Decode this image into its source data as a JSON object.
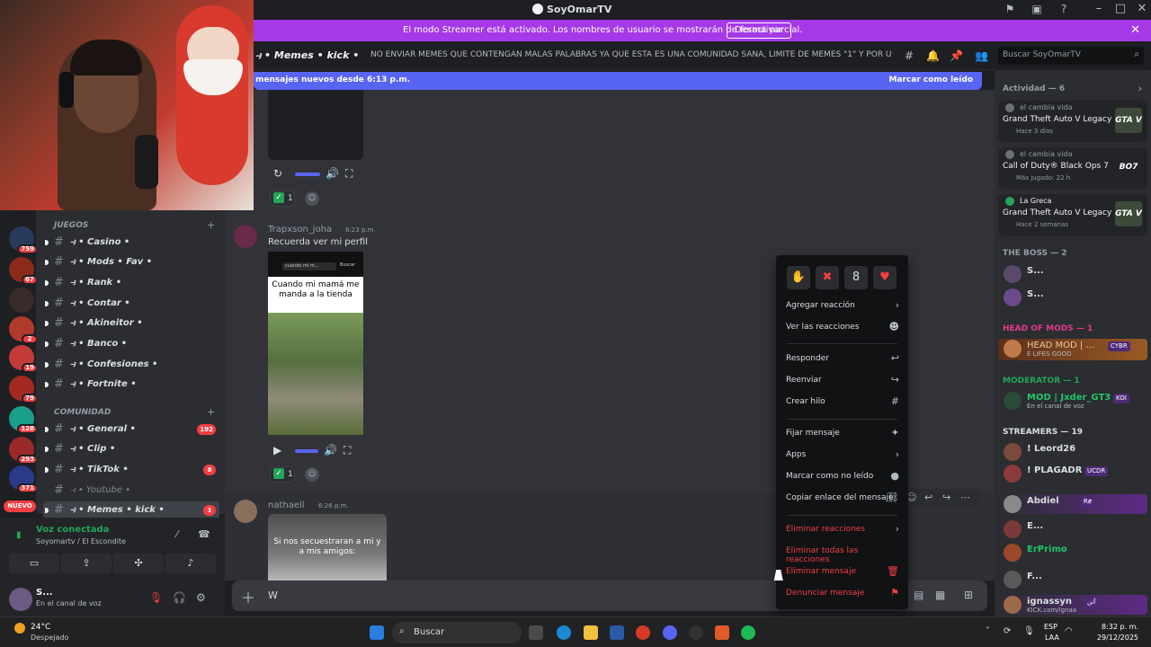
{
  "window": {
    "title": "SoyOmarTV"
  },
  "streamer_banner": {
    "text": "El modo Streamer está activado. Los nombres de usuario se mostrarán de forma parcial.",
    "button": "Desactivar"
  },
  "channel_header": {
    "name": "⥽ • Memes • kick •",
    "topic": "NO ENVIAR MEMES QUE CONTENGAN MALAS PALABRAS YA QUE ESTA ES UNA COMUNIDAD SANA, LIMITE DE MEMES \"1\" Y POR ULTIMO E...",
    "search_placeholder": "Buscar SoyOmarTV"
  },
  "new_messages_bar": {
    "left": "mensajes nuevos desde 6:13 p.m.",
    "right": "Marcar como leído"
  },
  "server_rail": {
    "badges": [
      "759",
      "67",
      "2",
      "19",
      "79",
      "128",
      "293",
      "371"
    ],
    "nuevo": "NUEVO"
  },
  "channels": {
    "cat_juegos": "JUEGOS",
    "cat_comunidad": "COMUNIDAD",
    "items": [
      {
        "label": "⥽ • Casino •"
      },
      {
        "label": "⥽ • Mods • Fav •"
      },
      {
        "label": "⥽ • Rank •"
      },
      {
        "label": "⥽ • Contar •"
      },
      {
        "label": "⥽ • Akineitor •"
      },
      {
        "label": "⥽ • Banco •"
      },
      {
        "label": "⥽ • Confesiones •"
      },
      {
        "label": "⥽ • Fortnite •"
      },
      {
        "label": "⥽ • General •",
        "badge": "192"
      },
      {
        "label": "⥽ • Clip •"
      },
      {
        "label": "⥽ • TikTok •",
        "badge": "8"
      },
      {
        "label": "⥽ • Youtube •"
      },
      {
        "label": "⥽ • Memes • kick •",
        "badge": "1"
      }
    ]
  },
  "voice": {
    "status": "Voz conectada",
    "sub": "Soyomartv / El Escondite"
  },
  "user_panel": {
    "name": "S...",
    "status": "En el canal de voz"
  },
  "messages": {
    "m1_reaction_count": "1",
    "m2_author": "Trapxson_joha",
    "m2_time": "6:23 p.m.",
    "m2_text": "Recuerda ver mi perfil",
    "m2_search": "cuando mi m...",
    "m2_search_btn": "Buscar",
    "m2_caption": "Cuando mi mamá me manda a la tienda",
    "m2_reaction_count": "1",
    "m3_author": "nathaell",
    "m3_time": "6:26 p.m.",
    "m3_caption": "Si nos secuestraran a mi y a mis amigos:"
  },
  "composer": {
    "value": "W"
  },
  "context_menu": {
    "quick_reactions": [
      "✋",
      "✖",
      "8",
      "♥"
    ],
    "items": [
      {
        "label": "Agregar reacción",
        "icon": "chevron-right-icon"
      },
      {
        "label": "Ver las reacciones",
        "icon": "smile-icon"
      },
      {
        "label": "Responder",
        "icon": "reply-icon"
      },
      {
        "label": "Reenviar",
        "icon": "forward-icon"
      },
      {
        "label": "Crear hilo",
        "icon": "thread-icon"
      },
      {
        "label": "Fijar mensaje",
        "icon": "pin-icon"
      },
      {
        "label": "Apps",
        "icon": "chevron-right-icon"
      },
      {
        "label": "Marcar como no leído",
        "icon": "unread-icon"
      },
      {
        "label": "Copiar enlace del mensaje",
        "icon": "link-icon"
      },
      {
        "label": "Eliminar reacciones",
        "icon": "chevron-right-icon"
      },
      {
        "label": "Eliminar todas las reacciones",
        "icon": ""
      },
      {
        "label": "Eliminar mensaje",
        "icon": "trash-icon"
      },
      {
        "label": "Denunciar mensaje",
        "icon": "flag-icon"
      }
    ]
  },
  "right_sidebar": {
    "activity_header": "Actividad — 6",
    "activities": [
      {
        "who": "el cambia vida",
        "game": "Grand Theft Auto V Legacy",
        "when": "Hace 3 días",
        "logo": "GTA V"
      },
      {
        "who": "el cambia vida",
        "game": "Call of Duty® Black Ops 7",
        "when": "Más jugado: 22 h",
        "logo": "BO7"
      },
      {
        "who": "La Greca",
        "game": "Grand Theft Auto V Legacy",
        "when": "Hace 2 semanas",
        "logo": "GTA V"
      }
    ],
    "boss_header": "THE BOSS — 2",
    "boss_members": [
      "S...",
      "S..."
    ],
    "headmods_header": "HEAD OF MODS — 1",
    "headmods_member": {
      "name": "HEAD MOD | ...",
      "sub": "E LIFES GOOD",
      "tag": "CYBR"
    },
    "moderator_header": "MODERATOR — 1",
    "moderator_member": {
      "name": "MOD | Jxder_GT3",
      "sub": "En el canal de voz",
      "tag": "KOI"
    },
    "streamers_header": "STREAMERS — 19",
    "streamers": [
      {
        "name": "! Leord26",
        "tag": ""
      },
      {
        "name": "! PLAGADR",
        "tag": "UCDR"
      },
      {
        "name": "Abdiel",
        "tag": "Ɍɇ"
      },
      {
        "name": "E...",
        "tag": ""
      },
      {
        "name": "ErPrimo",
        "tag": ""
      },
      {
        "name": "F...",
        "tag": ""
      },
      {
        "name": "ignassyn",
        "tag": "آتن",
        "sub": "KICK.com/ignaa"
      }
    ]
  },
  "taskbar": {
    "temp": "24°C",
    "condition": "Despejado",
    "search": "Buscar",
    "lang1": "ESP",
    "lang2": "LAA",
    "time": "8:32 p. m.",
    "date": "29/12/2025"
  }
}
